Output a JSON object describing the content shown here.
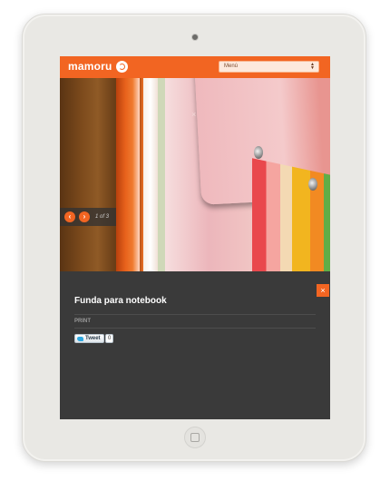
{
  "header": {
    "logo_text": "mamoru",
    "menu_select_value": "Menú",
    "brand_color": "#f26522"
  },
  "gallery": {
    "prev_icon": "chevron-left-icon",
    "next_icon": "chevron-right-icon",
    "counter": "1 of 3",
    "close_label": "×"
  },
  "panel": {
    "close_label": "×",
    "title": "Funda para notebook",
    "print_label": "PRINT",
    "tweet_label": "Tweet",
    "tweet_count": "0"
  }
}
